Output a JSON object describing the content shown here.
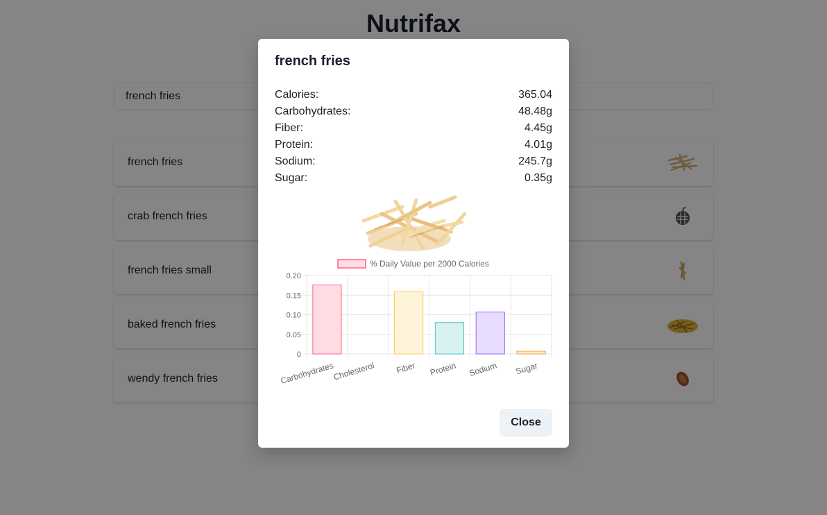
{
  "app": {
    "title": "Nutrifax"
  },
  "search": {
    "value": "french fries"
  },
  "results": [
    {
      "label": "french fries",
      "icon": "french-fries-thumbnail"
    },
    {
      "label": "crab french fries",
      "icon": "basket-placeholder-icon"
    },
    {
      "label": "french fries small",
      "icon": "small-fries-thumbnail"
    },
    {
      "label": "baked french fries",
      "icon": "baked-fries-thumbnail"
    },
    {
      "label": "wendy french fries",
      "icon": "wendy-fries-thumbnail"
    }
  ],
  "modal": {
    "title": "french fries",
    "nutrients": [
      {
        "label": "Calories:",
        "value": "365.04"
      },
      {
        "label": "Carbohydrates:",
        "value": "48.48g"
      },
      {
        "label": "Fiber:",
        "value": "4.45g"
      },
      {
        "label": "Protein:",
        "value": "4.01g"
      },
      {
        "label": "Sodium:",
        "value": "245.7g"
      },
      {
        "label": "Sugar:",
        "value": "0.35g"
      }
    ],
    "image_icon": "french-fries-photo",
    "close_label": "Close"
  },
  "chart_data": {
    "type": "bar",
    "legend": "% Daily Value per 2000 Calories",
    "legend_position": "top",
    "categories": [
      "Carbohydrates",
      "Cholesterol",
      "Fiber",
      "Protein",
      "Sodium",
      "Sugar"
    ],
    "values": [
      0.176,
      0,
      0.159,
      0.08,
      0.107,
      0.007
    ],
    "yticks": [
      "0.20",
      "0.15",
      "0.10",
      "0.05",
      "0"
    ],
    "ylim": [
      0,
      0.2
    ],
    "grid": true,
    "fills": [
      "#ffdce4",
      "#ffffff",
      "#fff3d9",
      "#d8f2f2",
      "#e8dcff",
      "#ffe8d4"
    ],
    "strokes": [
      "#ff6384",
      "#c9cbcf",
      "#ffcd56",
      "#4bc0c0",
      "#9966ff",
      "#ff9f40"
    ]
  },
  "colors": {
    "overlay": "#00000080",
    "modal_bg": "#ffffff",
    "button_bg": "#edf2f7",
    "text": "#1a202c"
  }
}
